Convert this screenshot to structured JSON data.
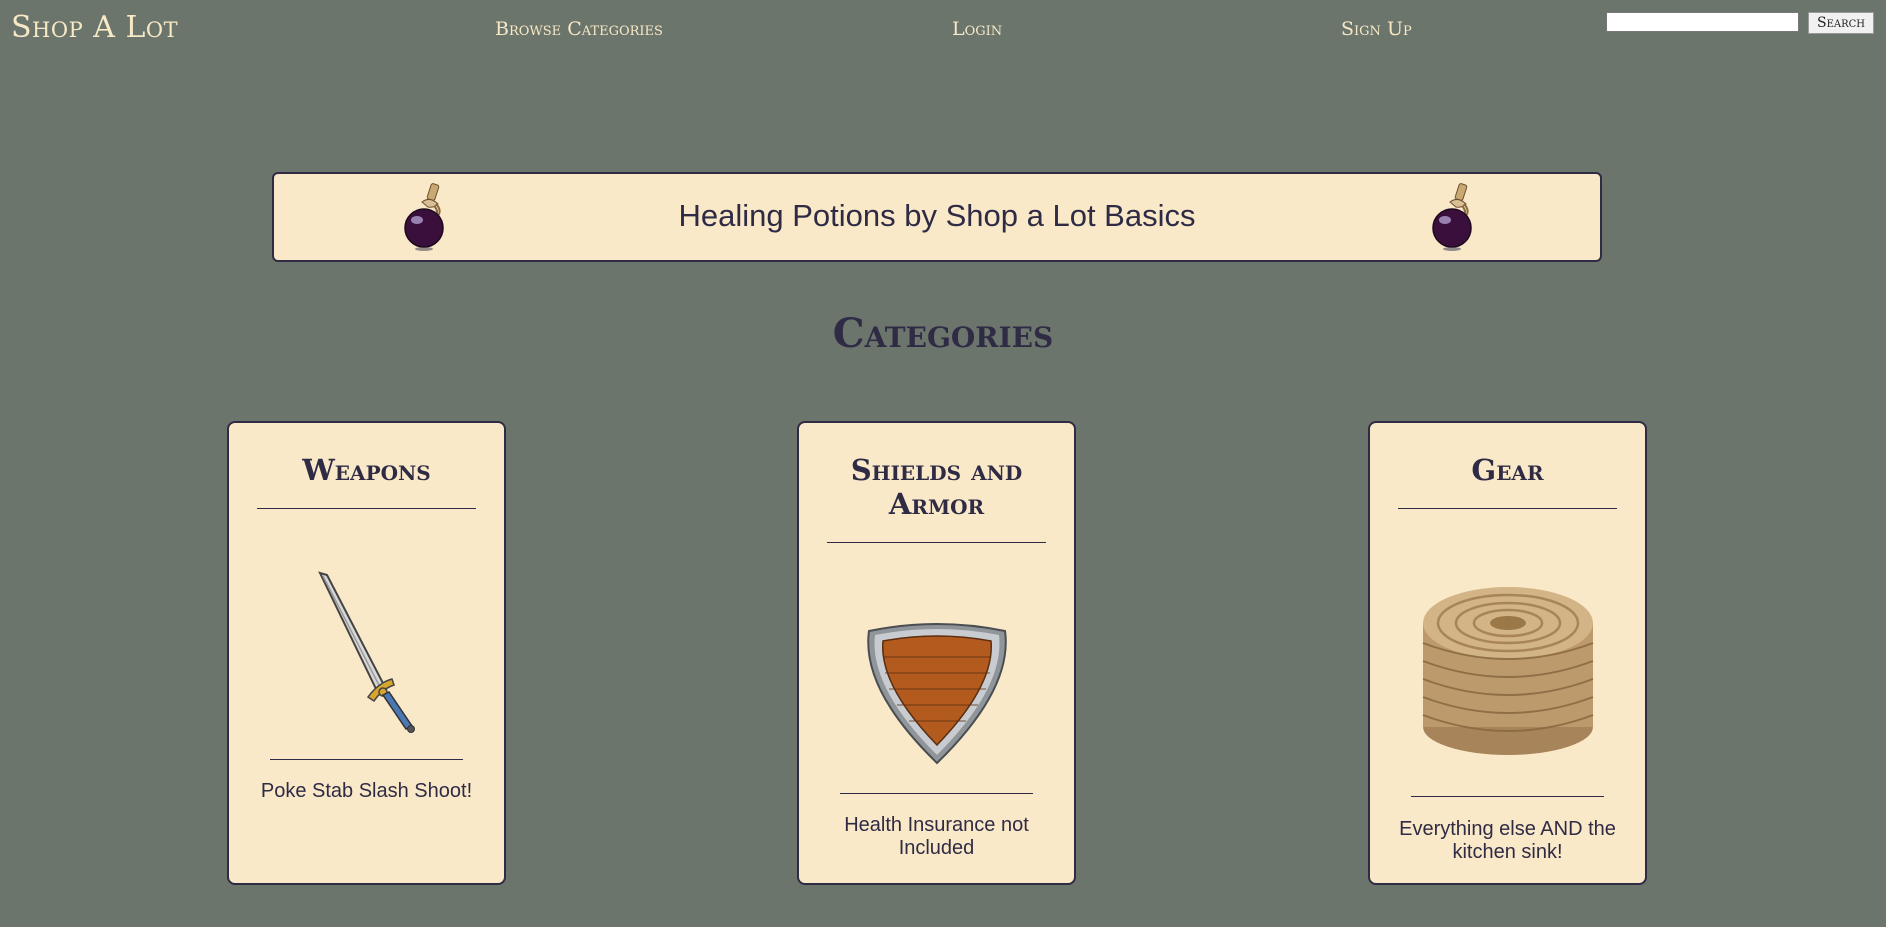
{
  "nav": {
    "brand": "Shop A Lot",
    "browse": "Browse Categories",
    "login": "Login",
    "signup": "Sign Up",
    "search_value": "",
    "search_button": "Search"
  },
  "banner": {
    "title": "Healing Potions by Shop a Lot Basics",
    "icon": "potion-icon"
  },
  "section_title": "Categories",
  "categories": [
    {
      "title": "Weapons",
      "description": "Poke Stab Slash Shoot!",
      "icon": "sword-icon"
    },
    {
      "title": "Shields and Armor",
      "description": "Health Insurance not Included",
      "icon": "shield-icon"
    },
    {
      "title": "Gear",
      "description": "Everything else AND the kitchen sink!",
      "icon": "rope-icon"
    }
  ],
  "colors": {
    "background": "#6b756c",
    "card": "#f9e9c8",
    "ink": "#2f2b45",
    "nav_text": "#f7e8c6"
  }
}
